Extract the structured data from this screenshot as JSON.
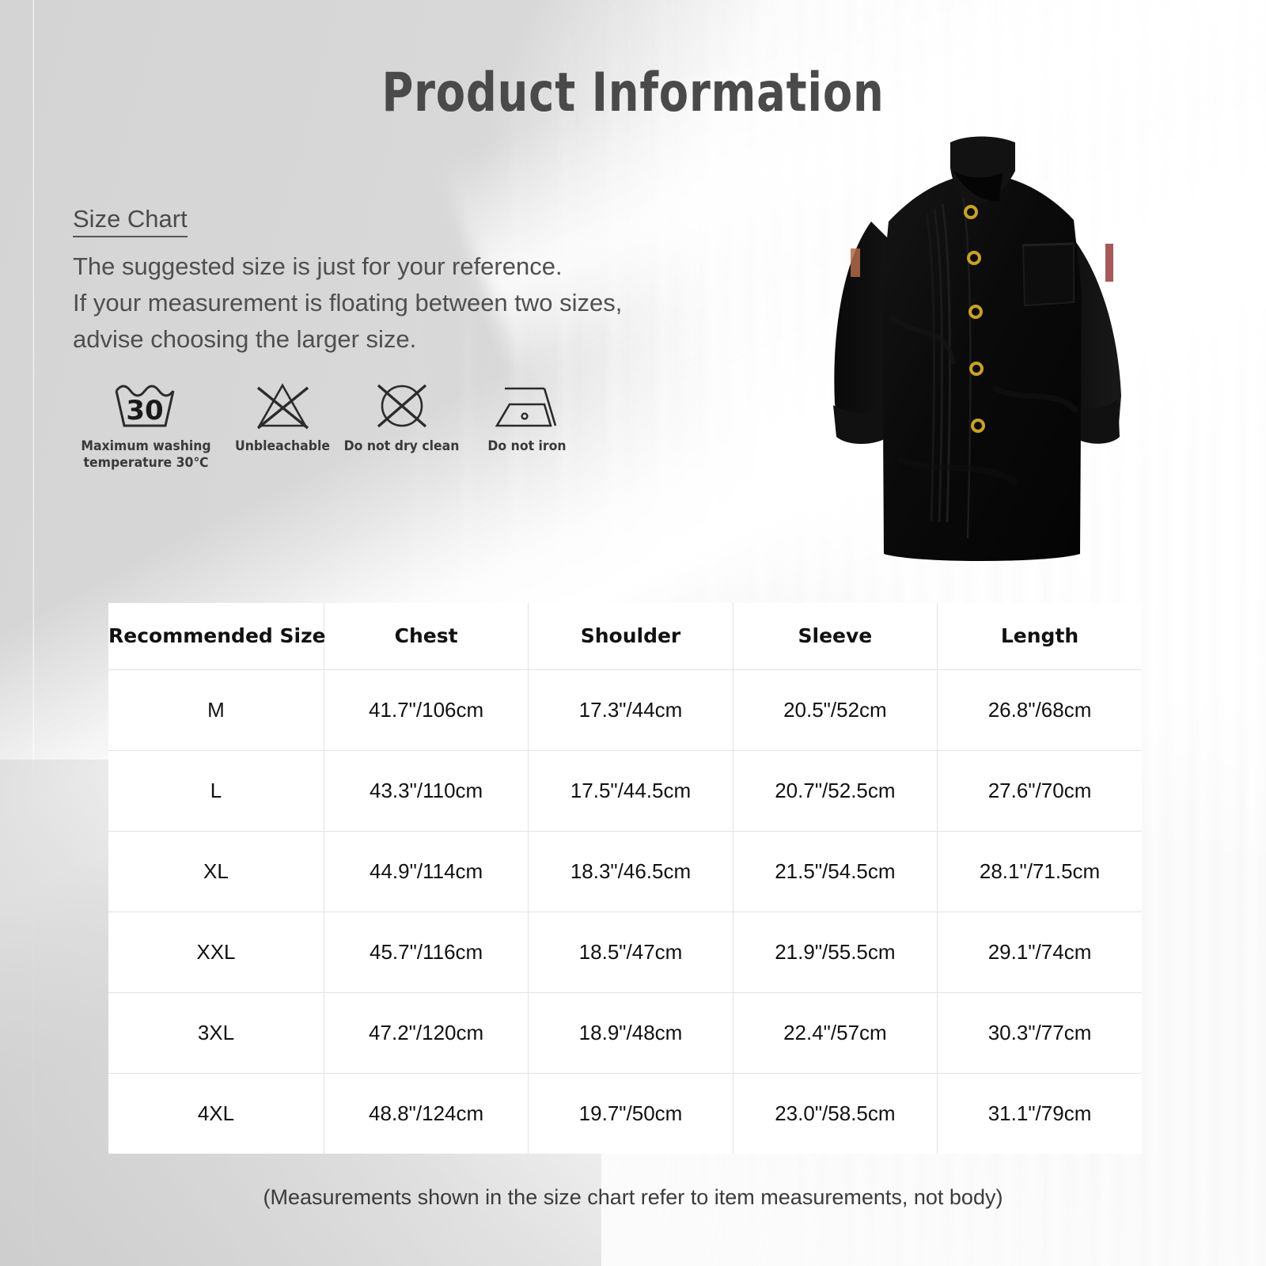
{
  "header": {
    "title": "Product  Information"
  },
  "size_chart_intro": {
    "heading": "Size Chart",
    "lines": [
      "The suggested size is just for your reference.",
      "If your measurement is floating between two sizes,",
      "advise choosing the larger size."
    ]
  },
  "care_instructions": [
    {
      "icon": "wash-tub-30-icon",
      "label": "Maximum washing\ntemperature 30℃",
      "value": "30"
    },
    {
      "icon": "do-not-bleach-icon",
      "label": "Unbleachable"
    },
    {
      "icon": "do-not-dry-clean-icon",
      "label": "Do not dry clean"
    },
    {
      "icon": "do-not-iron-icon",
      "label": "Do not iron"
    }
  ],
  "product_image": {
    "name": "chef-jacket-photo",
    "description": "Black chef coat, mandarin collar, double-breasted with brass snap buttons",
    "colors": {
      "fabric": "#0b0b0b",
      "button": "#c9a227",
      "tag": "#b06a4a"
    }
  },
  "chart_data": {
    "type": "table",
    "title": "Size Chart",
    "columns": [
      "Recommended Size",
      "Chest",
      "Shoulder",
      "Sleeve",
      "Length"
    ],
    "rows": [
      [
        "M",
        "41.7\"/106cm",
        "17.3\"/44cm",
        "20.5\"/52cm",
        "26.8\"/68cm"
      ],
      [
        "L",
        "43.3\"/110cm",
        "17.5\"/44.5cm",
        "20.7\"/52.5cm",
        "27.6\"/70cm"
      ],
      [
        "XL",
        "44.9\"/114cm",
        "18.3\"/46.5cm",
        "21.5\"/54.5cm",
        "28.1\"/71.5cm"
      ],
      [
        "XXL",
        "45.7\"/116cm",
        "18.5\"/47cm",
        "21.9\"/55.5cm",
        "29.1\"/74cm"
      ],
      [
        "3XL",
        "47.2\"/120cm",
        "18.9\"/48cm",
        "22.4\"/57cm",
        "30.3\"/77cm"
      ],
      [
        "4XL",
        "48.8\"/124cm",
        "19.7\"/50cm",
        "23.0\"/58.5cm",
        "31.1\"/79cm"
      ]
    ]
  },
  "footer": {
    "note": "(Measurements shown in the size chart refer to item measurements, not body)"
  },
  "colors": {
    "background_gray": "#d7d7d7",
    "table_background": "#ffffff",
    "table_border": "#e2e2e2",
    "title_text": "#4a4a4a",
    "body_text": "#4f4f4f"
  }
}
